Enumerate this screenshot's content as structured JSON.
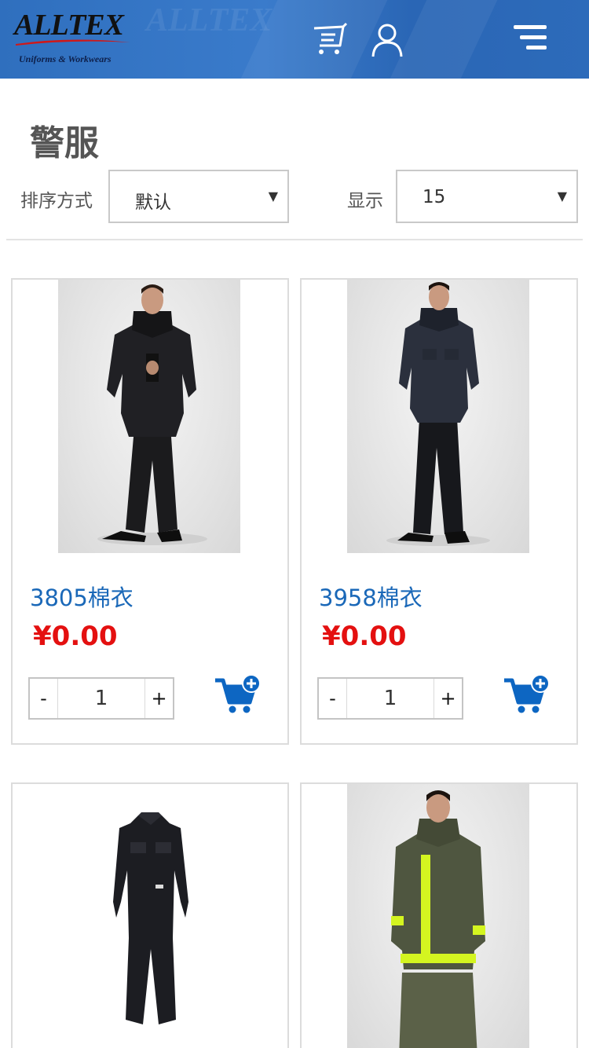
{
  "header": {
    "logo_text": "ALLTEX",
    "logo_subtitle": "Uniforms & Workwears",
    "icons": [
      "cart-icon",
      "user-icon",
      "menu-icon"
    ]
  },
  "page": {
    "title": "警服"
  },
  "filters": {
    "sort_label": "排序方式",
    "sort_value": "默认",
    "show_label": "显示",
    "show_value": "15"
  },
  "products": [
    {
      "name": "3805棉衣",
      "price": "¥0.00",
      "quantity": "1",
      "minus": "-",
      "plus": "+"
    },
    {
      "name": "3958棉衣",
      "price": "¥0.00",
      "quantity": "1",
      "minus": "-",
      "plus": "+"
    },
    {
      "name": "",
      "price": "",
      "quantity": "",
      "minus": "",
      "plus": ""
    },
    {
      "name": "",
      "price": "",
      "quantity": "",
      "minus": "",
      "plus": ""
    }
  ],
  "colors": {
    "header_blue": "#2f6fbe",
    "link_blue": "#1a68b8",
    "price_red": "#e41010",
    "cart_blue": "#0d66c2",
    "hivis_yellow": "#d4f520"
  }
}
